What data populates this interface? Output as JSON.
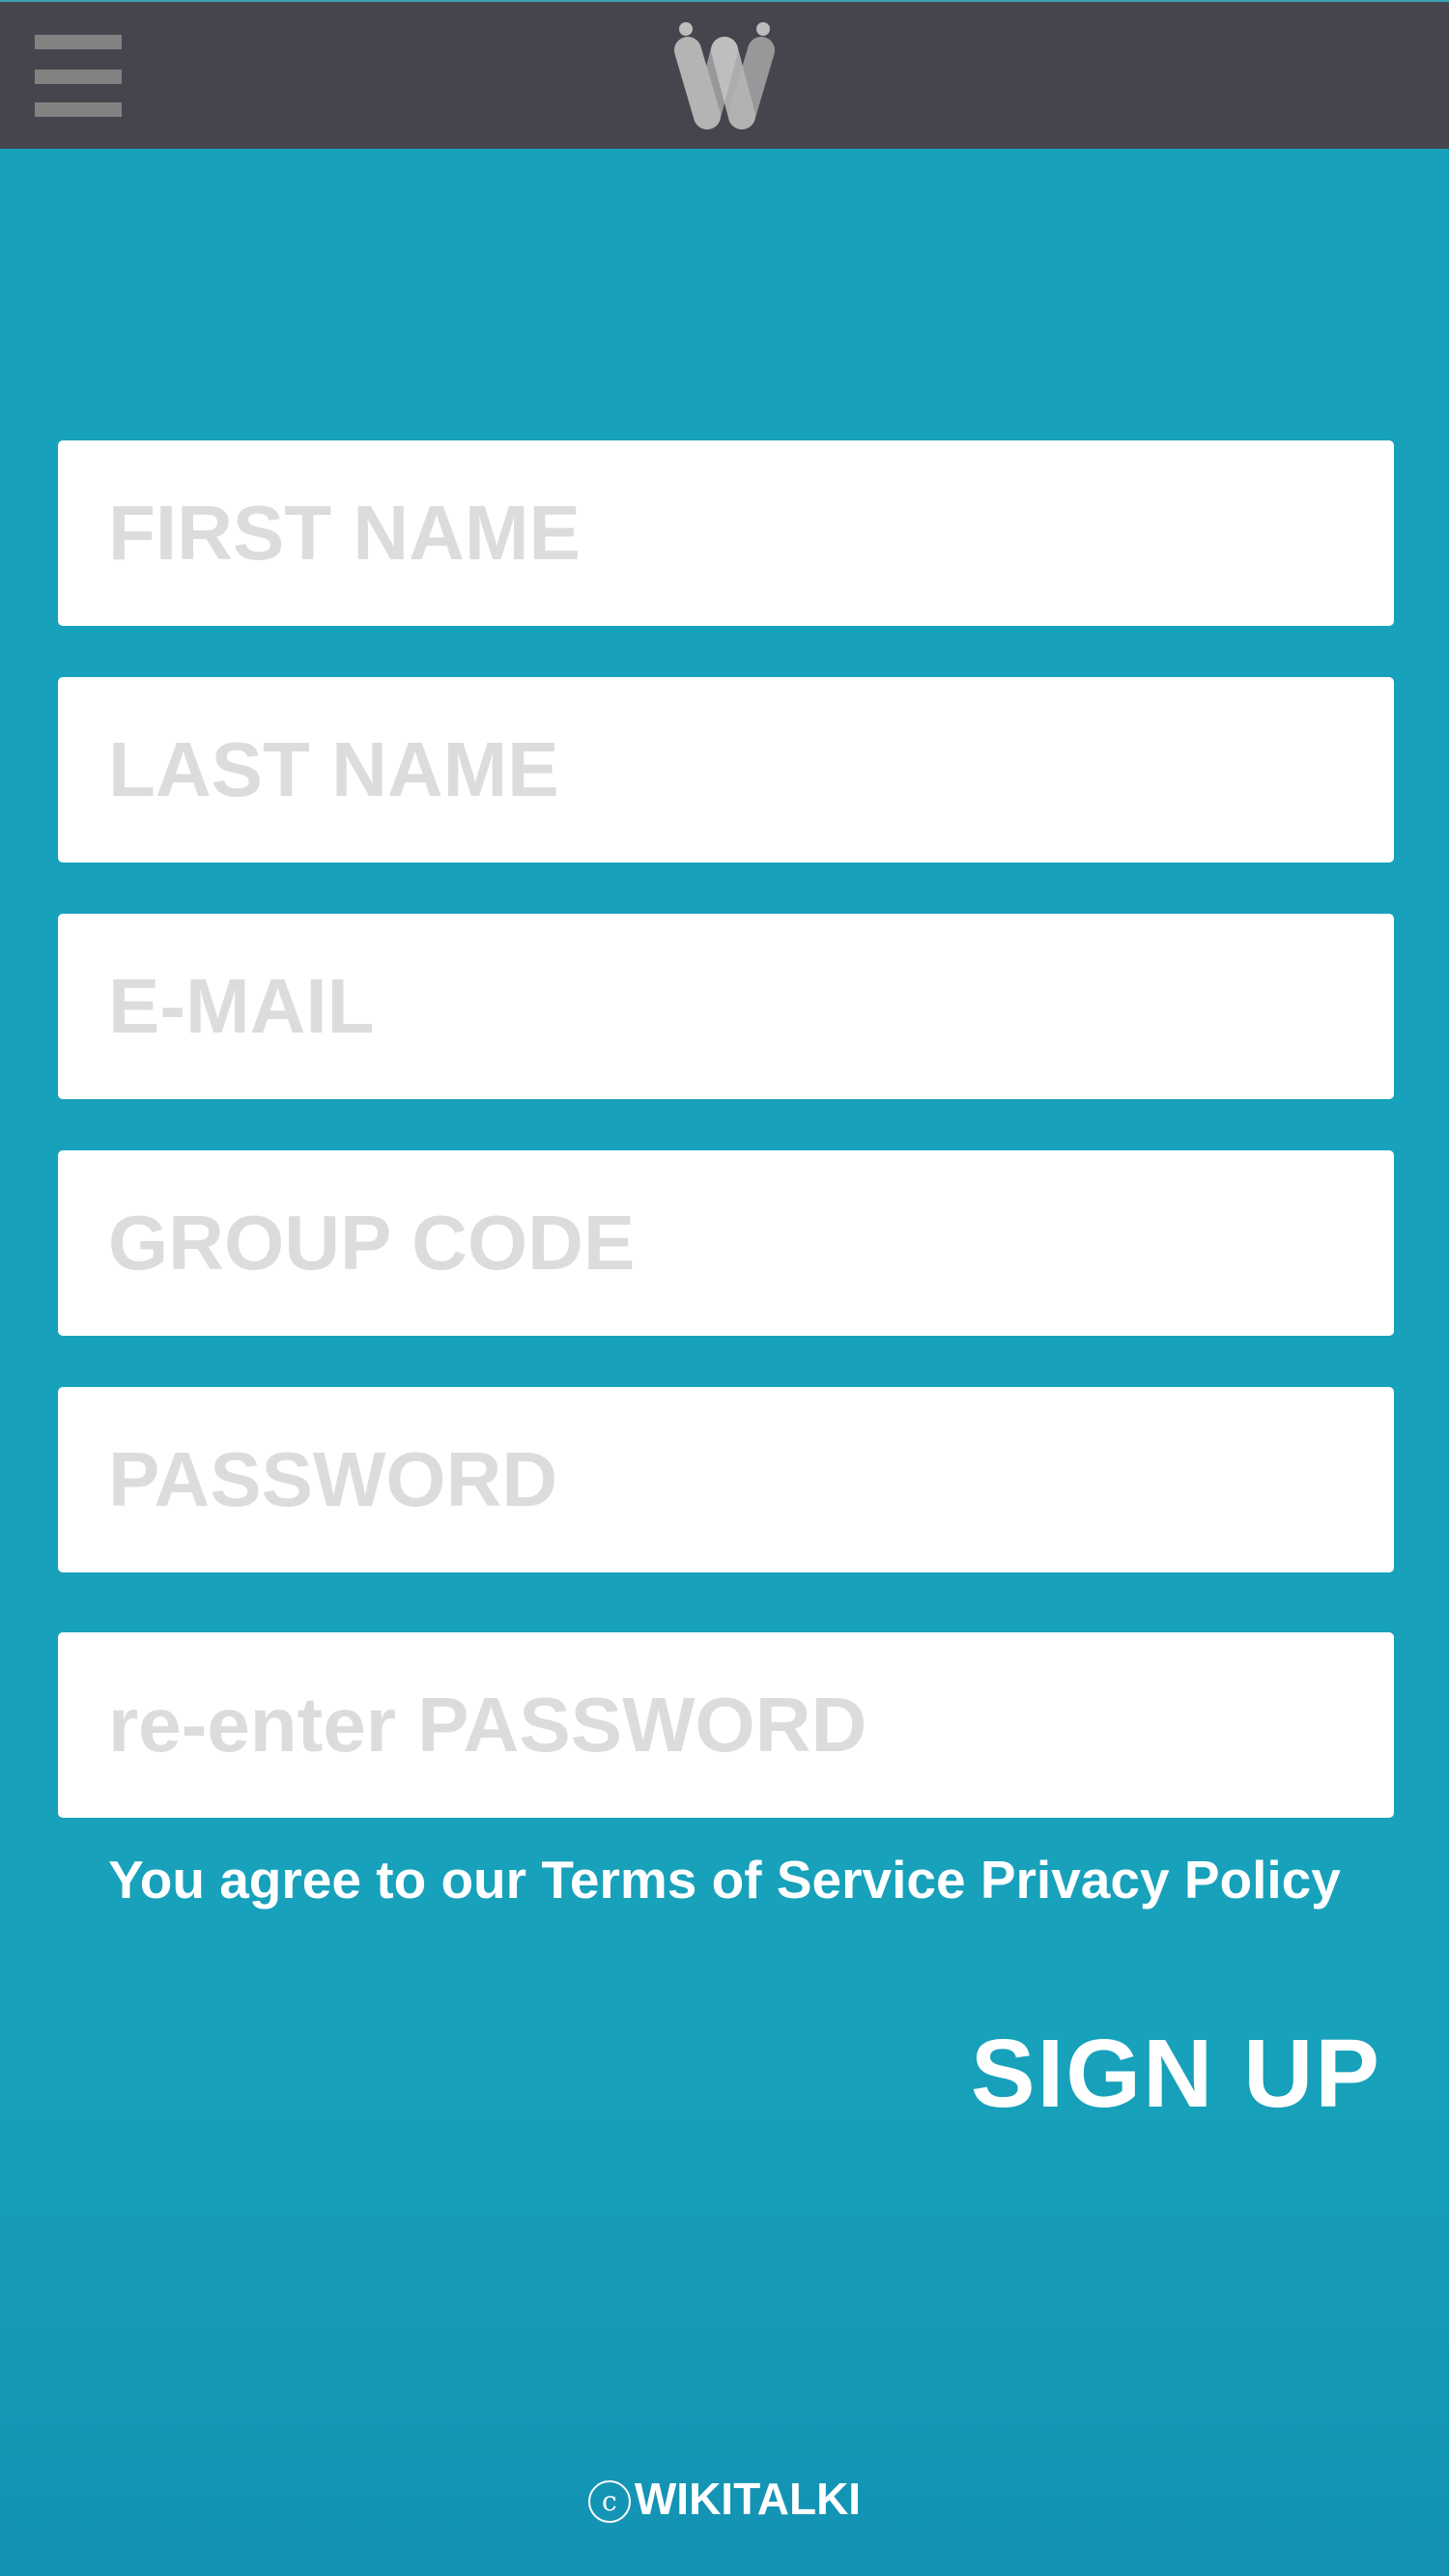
{
  "header": {
    "menu_icon": "hamburger-menu-icon",
    "logo_icon": "wikitalki-logo-icon"
  },
  "form": {
    "first_name": {
      "placeholder": "FIRST NAME",
      "value": ""
    },
    "last_name": {
      "placeholder": "LAST NAME",
      "value": ""
    },
    "email": {
      "placeholder": "E-MAIL",
      "value": ""
    },
    "group_code": {
      "placeholder": "GROUP CODE",
      "value": ""
    },
    "password": {
      "placeholder": "PASSWORD",
      "value": ""
    },
    "password_confirm": {
      "placeholder": "re-enter PASSWORD",
      "value": ""
    }
  },
  "terms": {
    "prefix": "You agree to our",
    "tos_label": "Terms of Service",
    "privacy_label": "Privacy Policy"
  },
  "actions": {
    "signup_label": "SIGN UP"
  },
  "footer": {
    "copyright_symbol": "c",
    "brand": "WIKITALKI"
  },
  "colors": {
    "background": "#17a1bb",
    "topbar": "#45454d",
    "placeholder": "#dcdcdc",
    "text_light": "#ffffff"
  }
}
